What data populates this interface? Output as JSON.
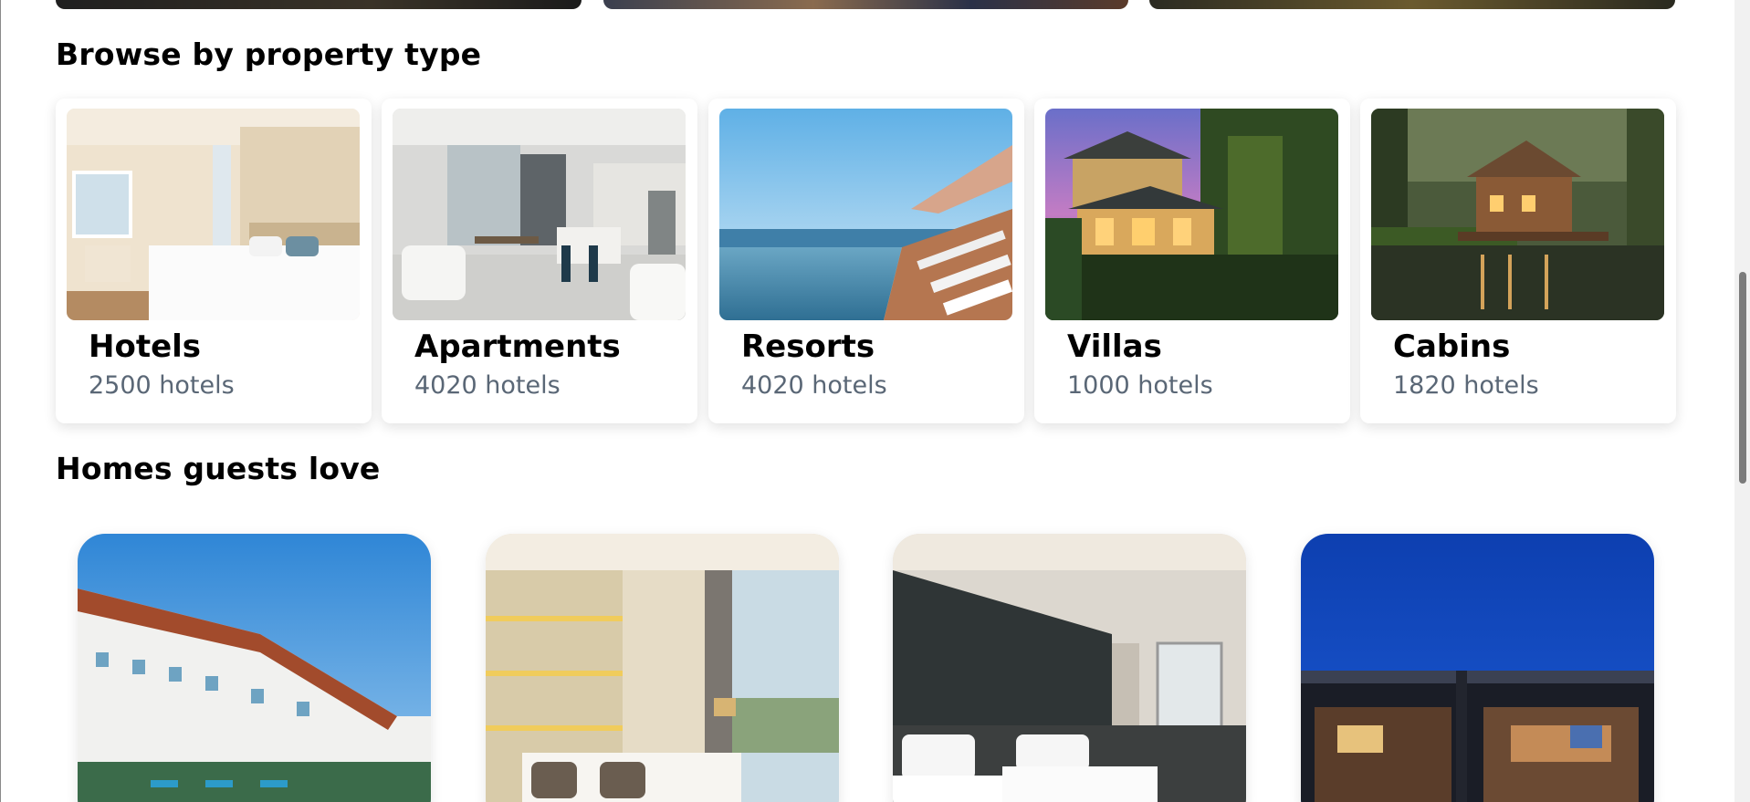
{
  "sections": {
    "property_types_title": "Browse by property type",
    "homes_title": "Homes guests love"
  },
  "property_types": [
    {
      "name": "Hotels",
      "count": "2500 hotels"
    },
    {
      "name": "Apartments",
      "count": "4020 hotels"
    },
    {
      "name": "Resorts",
      "count": "4020 hotels"
    },
    {
      "name": "Villas",
      "count": "1000 hotels"
    },
    {
      "name": "Cabins",
      "count": "1820 hotels"
    }
  ],
  "colors": {
    "count_text": "#5a6776",
    "title_text": "#000000",
    "card_bg": "#ffffff",
    "scroll_thumb": "#7b7b7b"
  }
}
